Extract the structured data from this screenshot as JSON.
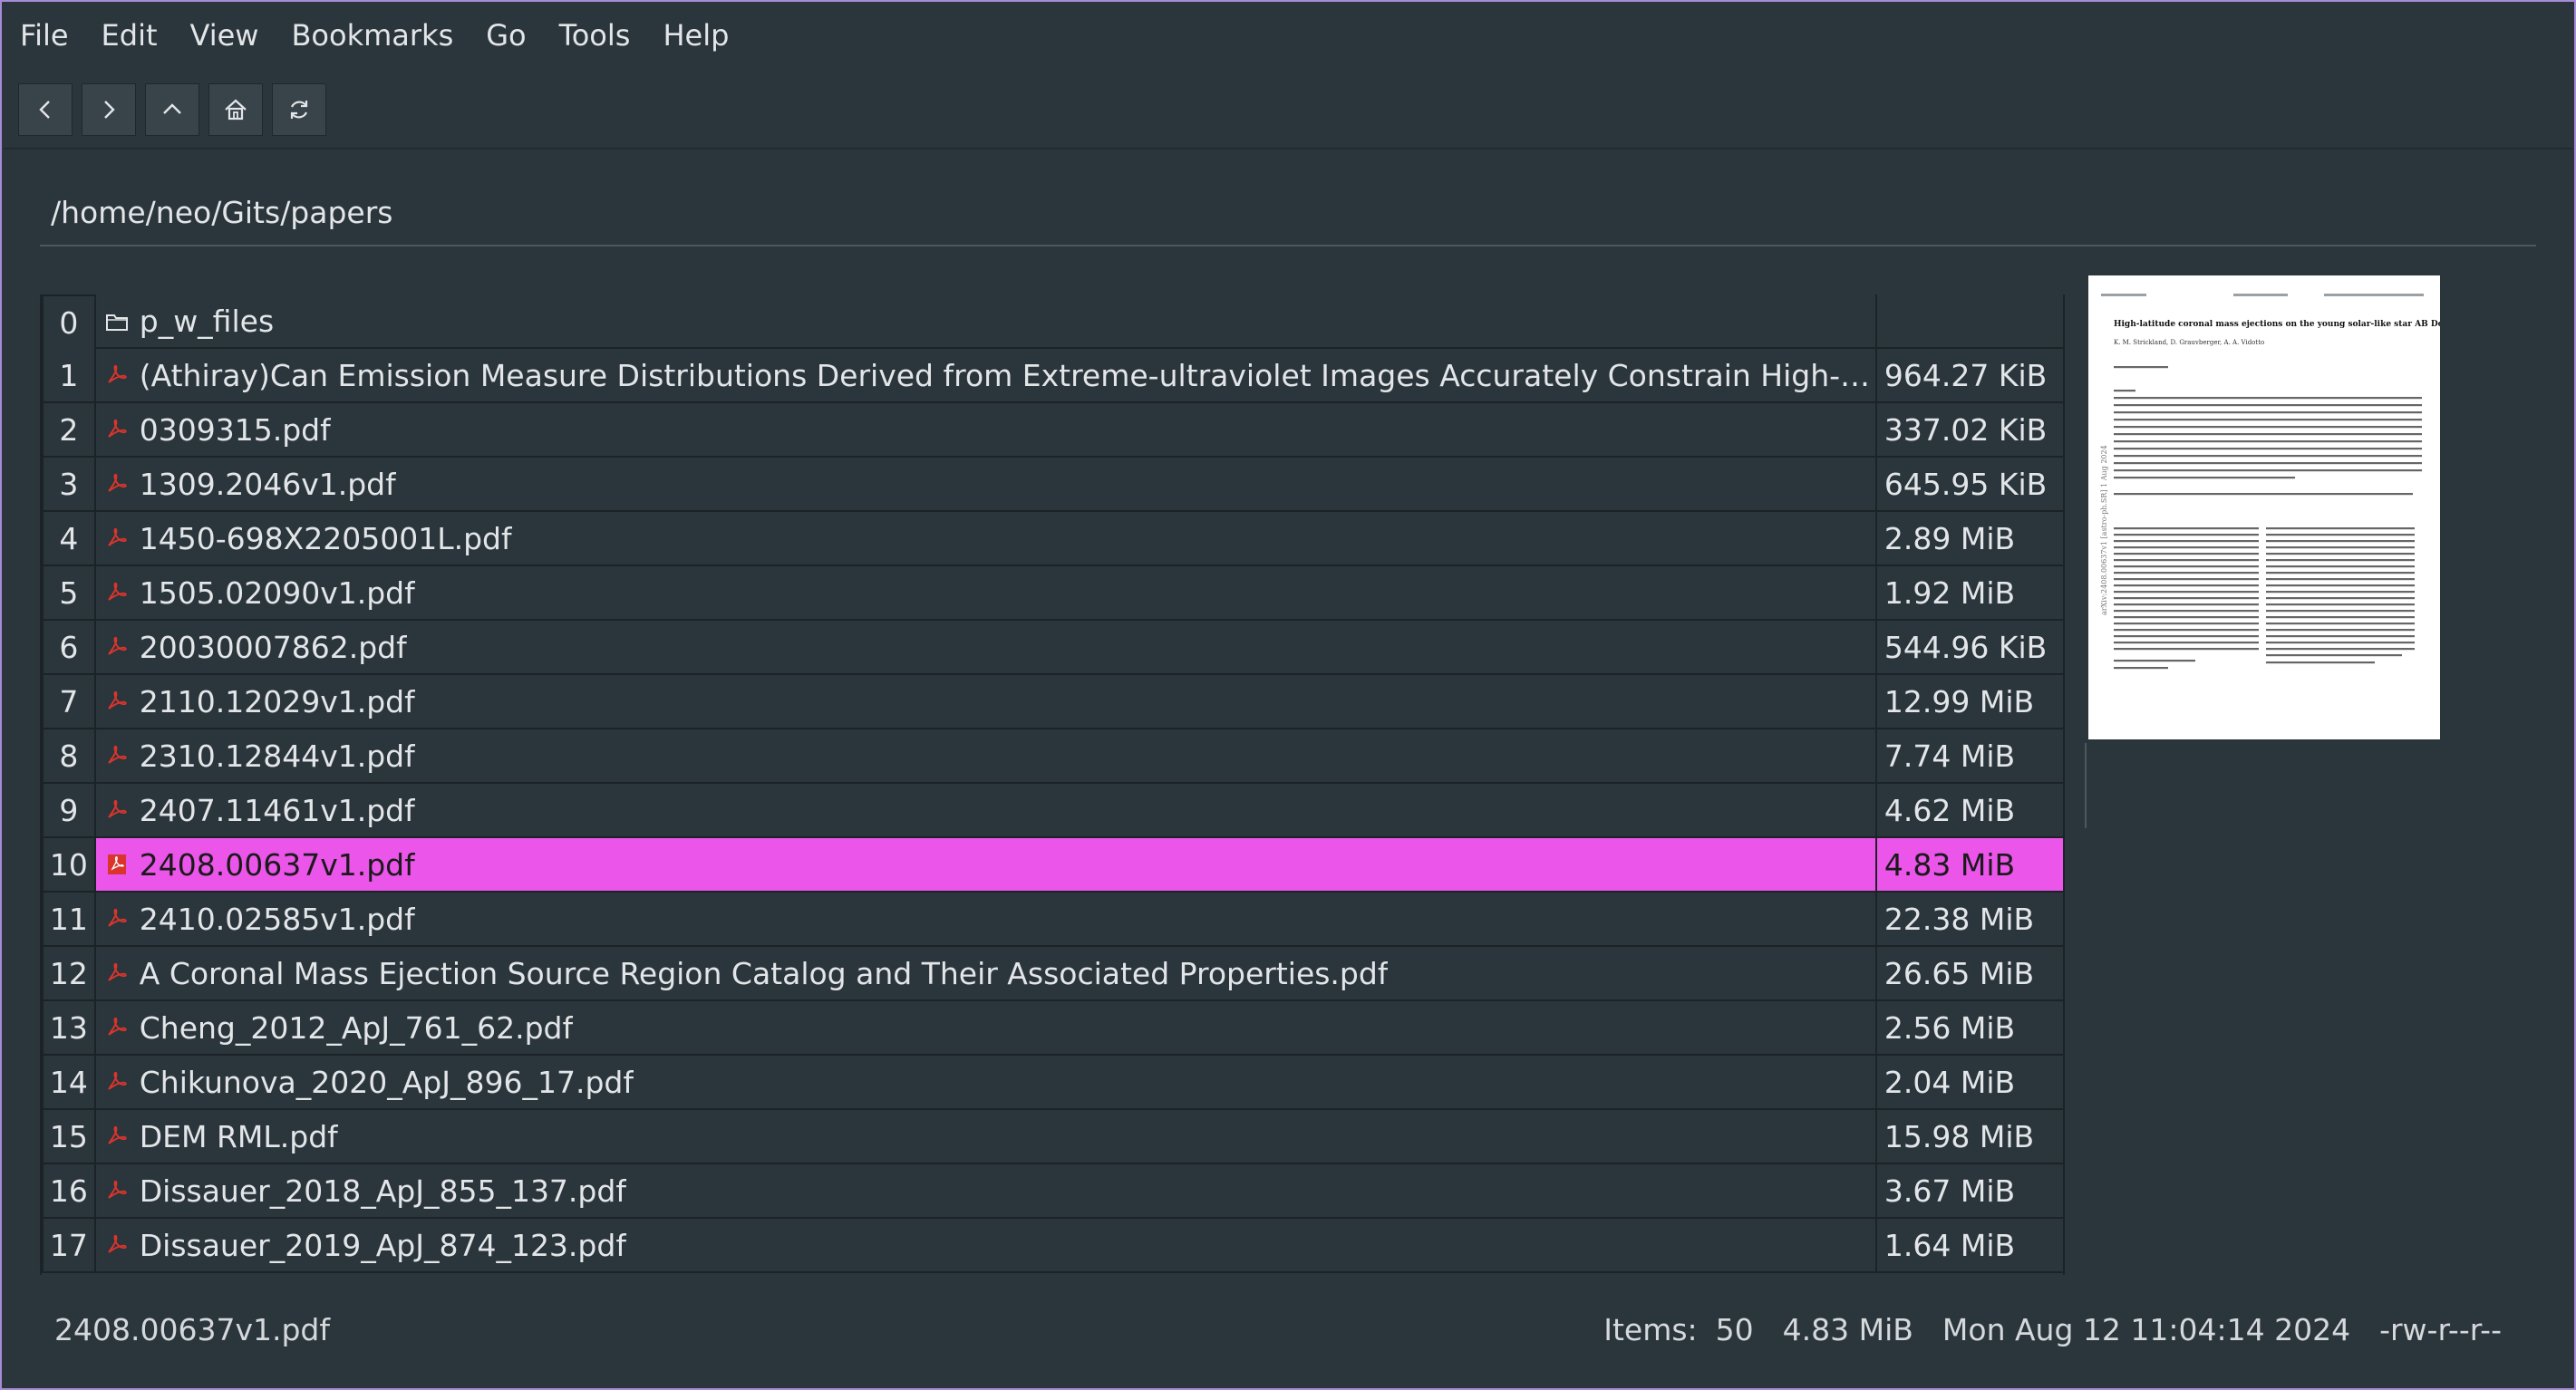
{
  "menu": [
    "File",
    "Edit",
    "View",
    "Bookmarks",
    "Go",
    "Tools",
    "Help"
  ],
  "toolbar": {
    "buttons": [
      {
        "icon": "back-icon"
      },
      {
        "icon": "forward-icon"
      },
      {
        "icon": "up-icon"
      },
      {
        "icon": "home-icon"
      },
      {
        "icon": "refresh-icon"
      }
    ]
  },
  "path": "/home/neo/Gits/papers",
  "files": [
    {
      "index": "0",
      "name": "p_w_files",
      "size": "",
      "type": "folder"
    },
    {
      "index": "1",
      "name": "(Athiray)Can Emission Measure Distributions Derived from Extreme-ultraviolet Images Accurately Constrain High-temperature…",
      "size": "964.27 KiB",
      "type": "pdf"
    },
    {
      "index": "2",
      "name": "0309315.pdf",
      "size": "337.02 KiB",
      "type": "pdf"
    },
    {
      "index": "3",
      "name": "1309.2046v1.pdf",
      "size": "645.95 KiB",
      "type": "pdf"
    },
    {
      "index": "4",
      "name": "1450-698X2205001L.pdf",
      "size": "2.89 MiB",
      "type": "pdf"
    },
    {
      "index": "5",
      "name": "1505.02090v1.pdf",
      "size": "1.92 MiB",
      "type": "pdf"
    },
    {
      "index": "6",
      "name": "20030007862.pdf",
      "size": "544.96 KiB",
      "type": "pdf"
    },
    {
      "index": "7",
      "name": "2110.12029v1.pdf",
      "size": "12.99 MiB",
      "type": "pdf"
    },
    {
      "index": "8",
      "name": "2310.12844v1.pdf",
      "size": "7.74 MiB",
      "type": "pdf"
    },
    {
      "index": "9",
      "name": "2407.11461v1.pdf",
      "size": "4.62 MiB",
      "type": "pdf"
    },
    {
      "index": "10",
      "name": "2408.00637v1.pdf",
      "size": "4.83 MiB",
      "type": "pdf",
      "selected": true
    },
    {
      "index": "11",
      "name": "2410.02585v1.pdf",
      "size": "22.38 MiB",
      "type": "pdf"
    },
    {
      "index": "12",
      "name": "A Coronal Mass Ejection Source Region Catalog and Their Associated Properties.pdf",
      "size": "26.65 MiB",
      "type": "pdf"
    },
    {
      "index": "13",
      "name": "Cheng_2012_ApJ_761_62.pdf",
      "size": "2.56 MiB",
      "type": "pdf"
    },
    {
      "index": "14",
      "name": "Chikunova_2020_ApJ_896_17.pdf",
      "size": "2.04 MiB",
      "type": "pdf"
    },
    {
      "index": "15",
      "name": "DEM RML.pdf",
      "size": "15.98 MiB",
      "type": "pdf"
    },
    {
      "index": "16",
      "name": "Dissauer_2018_ApJ_855_137.pdf",
      "size": "3.67 MiB",
      "type": "pdf"
    },
    {
      "index": "17",
      "name": "Dissauer_2019_ApJ_874_123.pdf",
      "size": "1.64 MiB",
      "type": "pdf"
    }
  ],
  "preview": {
    "title": "High-latitude coronal mass ejections on the young solar-like star AB Dor",
    "authors": "K. M. Strickland, D. Grauvberger, A. A. Vidotto",
    "side_text": "arXiv:2408.00637v1 [astro-ph.SR] 1 Aug 2024"
  },
  "status": {
    "selected_name": "2408.00637v1.pdf",
    "items_label": "Items:",
    "items_count": "50",
    "size": "4.83 MiB",
    "modified": "Mon Aug 12 11:04:14 2024",
    "permissions": "-rw-r--r--"
  },
  "colors": {
    "background": "#2b353c",
    "selection": "#eb55ea",
    "pdf_icon": "#d9352c",
    "frame": "#a78bd6"
  }
}
